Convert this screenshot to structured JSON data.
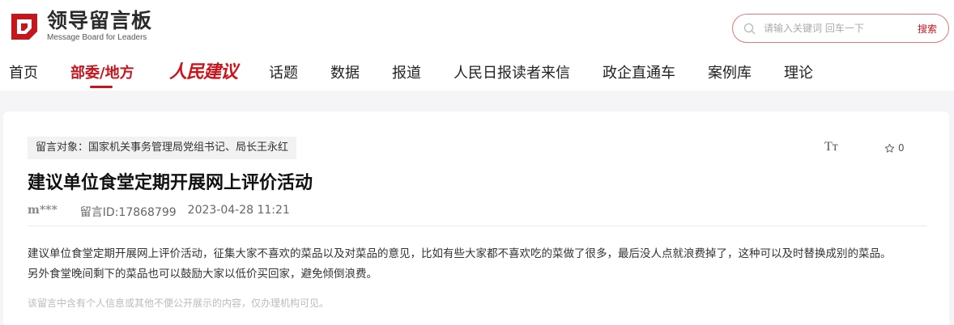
{
  "header": {
    "logo_cn": "领导留言板",
    "logo_en": "Message Board for Leaders",
    "search_placeholder": "请输入关键词 回车一下",
    "search_button": "搜索"
  },
  "nav": {
    "items": [
      "首页",
      "部委/地方",
      "人民建议",
      "话题",
      "数据",
      "报道",
      "人民日报读者来信",
      "政企直通车",
      "案例库",
      "理论"
    ],
    "active_index": 1
  },
  "message": {
    "target": "留言对象：国家机关事务管理局党组书记、局长王永红",
    "font_toggle": "Tт",
    "favorite_count": "0",
    "title": "建议单位食堂定期开展网上评价活动",
    "author": "m***",
    "message_id": "留言ID:17868799",
    "datetime": "2023-04-28 11:21",
    "content_line1": "建议单位食堂定期开展网上评价活动，征集大家不喜欢的菜品以及对菜品的意见，比如有些大家都不喜欢吃的菜做了很多，最后没人点就浪费掉了，这种可以及时替换成别的菜品。",
    "content_line2": "另外食堂晚间剩下的菜品也可以鼓励大家以低价买回家，避免倾倒浪费。",
    "privacy_note": "该留言中含有个人信息或其他不便公开展示的内容，仅办理机构可见。"
  },
  "colors": {
    "brand_red": "#c4161c",
    "page_bg": "#f5f5f7"
  }
}
